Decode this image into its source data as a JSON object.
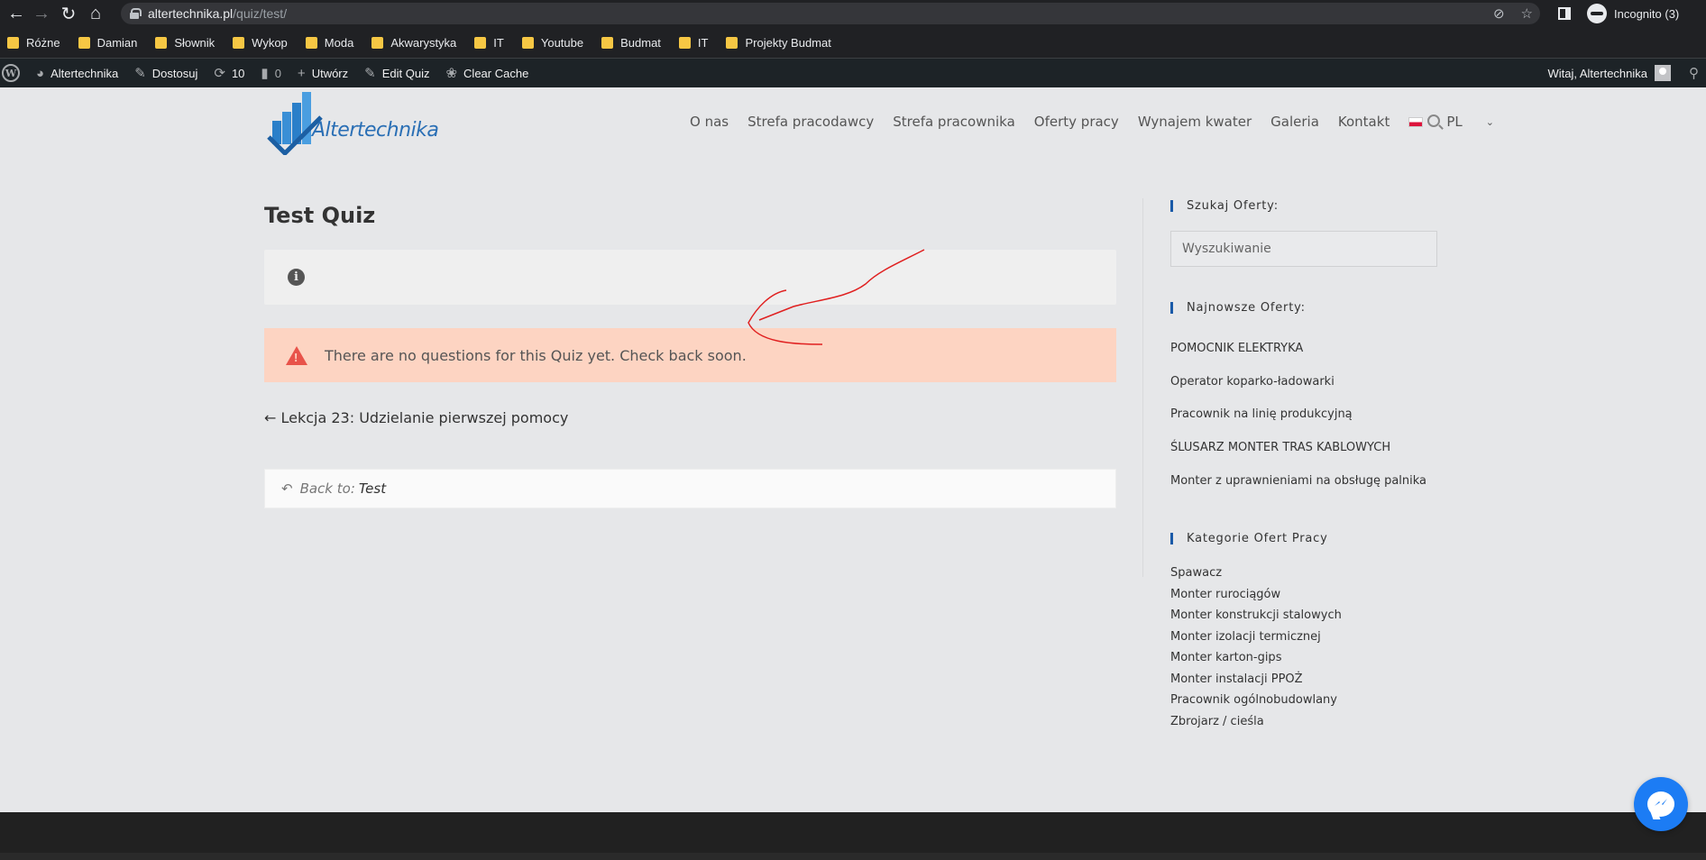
{
  "browser": {
    "url_host": "altertechnika.pl",
    "url_path": "/quiz/test/",
    "profile_label": "Incognito (3)",
    "bookmarks": [
      "Różne",
      "Damian",
      "Słownik",
      "Wykop",
      "Moda",
      "Akwarystyka",
      "IT",
      "Youtube",
      "Budmat",
      "IT",
      "Projekty Budmat"
    ]
  },
  "admin_bar": {
    "site_name": "Altertechnika",
    "customize": "Dostosuj",
    "updates_count": "10",
    "comments_count": "0",
    "new_label": "Utwórz",
    "edit_label": "Edit Quiz",
    "clear_cache": "Clear Cache",
    "greeting": "Witaj, Altertechnika"
  },
  "site": {
    "logo_text": "Altertechnika",
    "nav": [
      "O nas",
      "Strefa pracodawcy",
      "Strefa pracownika",
      "Oferty pracy",
      "Wynajem kwater",
      "Galeria",
      "Kontakt"
    ],
    "lang": "PL"
  },
  "content": {
    "title": "Test Quiz",
    "alert": "There are no questions for this Quiz yet. Check back soon.",
    "prev_lesson": "← Lekcja 23: Udzielanie pierwszej pomocy",
    "back_to_label": "Back to:",
    "back_to_link": "Test"
  },
  "sidebar": {
    "search_heading": "Szukaj Oferty:",
    "search_placeholder": "Wyszukiwanie",
    "latest_heading": "Najnowsze Oferty:",
    "latest": [
      "POMOCNIK ELEKTRYKA",
      "Operator koparko-ładowarki",
      "Pracownik na linię produkcyjną",
      "ŚLUSARZ MONTER TRAS KABLOWYCH",
      "Monter z uprawnieniami na obsługę palnika"
    ],
    "categories_heading": "Kategorie Ofert Pracy",
    "categories": [
      "Spawacz",
      "Monter rurociągów",
      "Monter konstrukcji stalowych",
      "Monter izolacji termicznej",
      "Monter karton-gips",
      "Monter instalacji PPOŻ",
      "Pracownik ogólnobudowlany",
      "Zbrojarz / cieśla"
    ]
  },
  "colors": {
    "accent": "#1a5aa8",
    "alert_bg": "#fdd4c2",
    "alert_icon": "#e8534a",
    "annotation": "#e02020"
  }
}
